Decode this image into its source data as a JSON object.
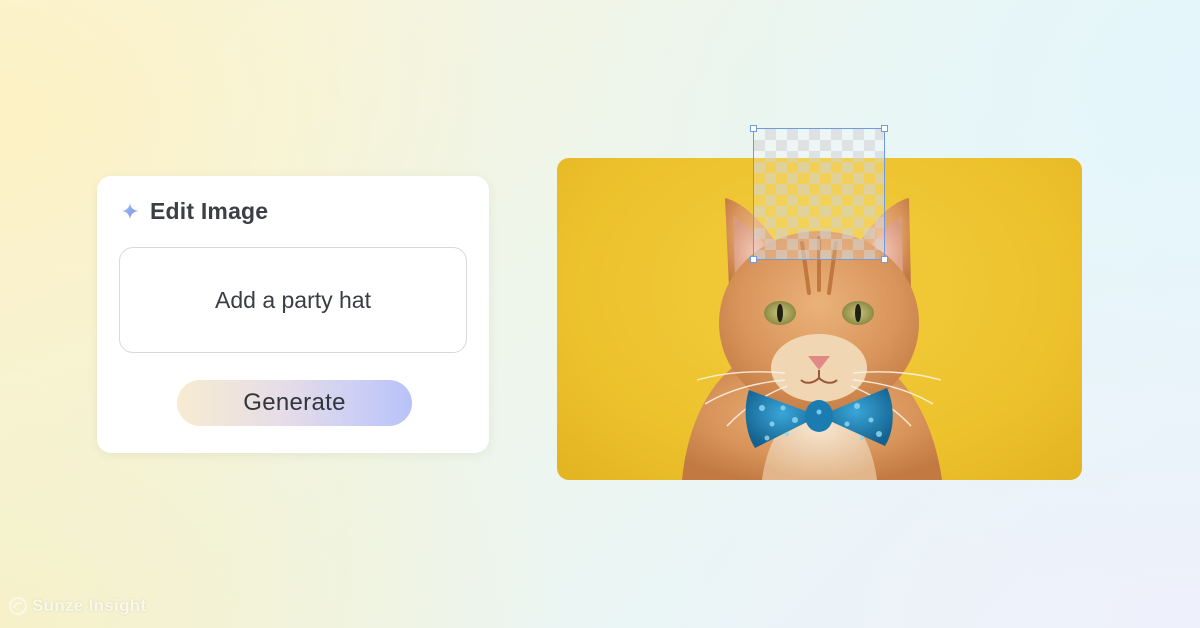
{
  "panel": {
    "title": "Edit Image",
    "title_icon": "sparkle-icon",
    "prompt_text": "Add a party hat",
    "generate_label": "Generate"
  },
  "image": {
    "subject": "orange tabby cat wearing a blue sequin bow tie on a yellow background",
    "background_color": "#ecc12c"
  },
  "selection": {
    "border_color": "#6f9ce0"
  },
  "watermark": {
    "text": "Sunze Insight",
    "icon": "logo-icon"
  },
  "colors": {
    "generate_gradient_start": "#f7ecd0",
    "generate_gradient_end": "#b8c2f8",
    "panel_background": "#ffffff"
  }
}
